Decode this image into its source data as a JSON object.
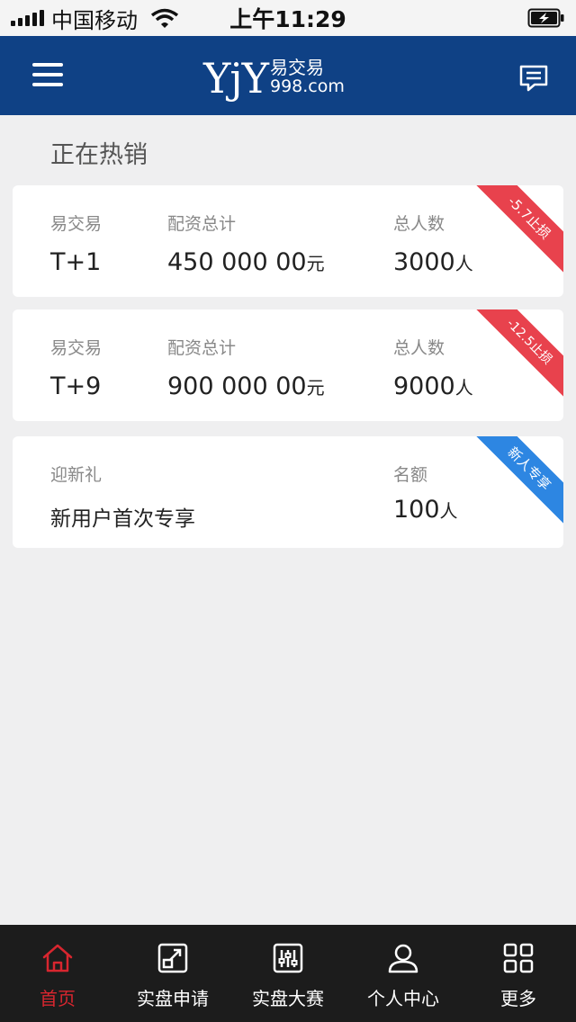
{
  "status_bar": {
    "carrier": "中国移动",
    "time": "上午11:29"
  },
  "header": {
    "logo_mark": "YjY",
    "logo_cn": "易交易",
    "logo_en": "998.com"
  },
  "section_title": "正在热销",
  "products": [
    {
      "name_label": "易交易",
      "name_value": "T+1",
      "capital_label": "配资总计",
      "capital_value": "450 000 00",
      "capital_unit": "元",
      "count_label": "总人数",
      "count_value": "3000",
      "count_unit": "人",
      "badge": "-5.7止损",
      "badge_color": "#e8424d"
    },
    {
      "name_label": "易交易",
      "name_value": "T+9",
      "capital_label": "配资总计",
      "capital_value": "900 000 00",
      "capital_unit": "元",
      "count_label": "总人数",
      "count_value": "9000",
      "count_unit": "人",
      "badge": "-12.5止损",
      "badge_color": "#e8424d"
    }
  ],
  "welcome": {
    "label": "迎新礼",
    "value": "新用户首次专享",
    "quota_label": "名额",
    "quota_value": "100",
    "quota_unit": "人",
    "badge": "新人专享",
    "badge_color": "#2d86e2"
  },
  "tabs": [
    {
      "label": "首页",
      "icon": "home-icon",
      "active": true
    },
    {
      "label": "实盘申请",
      "icon": "apply-icon"
    },
    {
      "label": "实盘大赛",
      "icon": "contest-icon"
    },
    {
      "label": "个人中心",
      "icon": "user-icon"
    },
    {
      "label": "更多",
      "icon": "grid-icon"
    }
  ],
  "colors": {
    "header": "#0f4185",
    "tab_active": "#d8262f",
    "tabbar": "#1c1c1c"
  }
}
